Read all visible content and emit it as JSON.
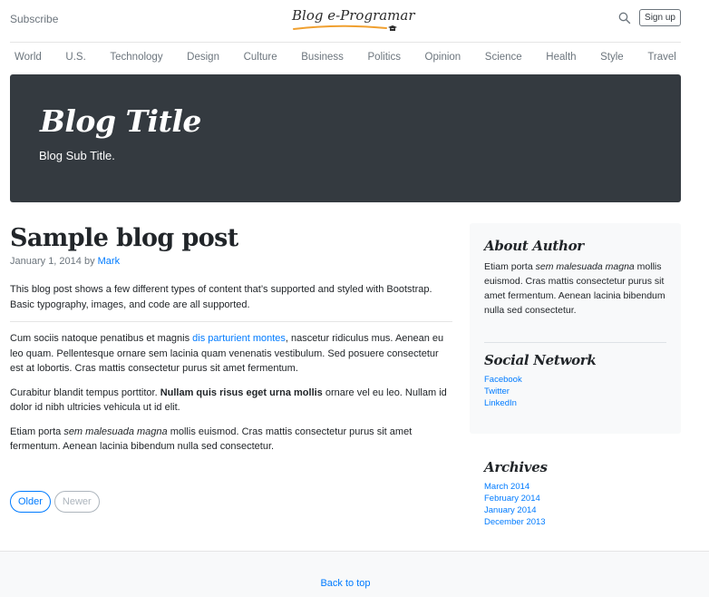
{
  "header": {
    "subscribe": "Subscribe",
    "logo": "Blog e-Programar",
    "signup": "Sign up",
    "search_icon": "search-icon"
  },
  "nav": {
    "items": [
      "World",
      "U.S.",
      "Technology",
      "Design",
      "Culture",
      "Business",
      "Politics",
      "Opinion",
      "Science",
      "Health",
      "Style",
      "Travel"
    ]
  },
  "jumbotron": {
    "title": "Blog Title",
    "subtitle": "Blog Sub Title."
  },
  "post": {
    "title": "Sample blog post",
    "date": "January 1, 2014 by",
    "author": "Mark",
    "intro": "This blog post shows a few different types of content that’s supported and styled with Bootstrap. Basic typography, images, and code are all supported.",
    "p2_before": "Cum sociis natoque penatibus et magnis ",
    "p2_link": "dis parturient montes",
    "p2_after": ", nascetur ridiculus mus. Aenean eu leo quam. Pellentesque ornare sem lacinia quam venenatis vestibulum. Sed posuere consectetur est at lobortis. Cras mattis consectetur purus sit amet fermentum.",
    "p3_before": "Curabitur blandit tempus porttitor. ",
    "p3_bold": "Nullam quis risus eget urna mollis",
    "p3_after": " ornare vel eu leo. Nullam id dolor id nibh ultricies vehicula ut id elit.",
    "p4_before": "Etiam porta ",
    "p4_em": "sem malesuada magna",
    "p4_after": " mollis euismod. Cras mattis consectetur purus sit amet fermentum. Aenean lacinia bibendum nulla sed consectetur."
  },
  "pager": {
    "older": "Older",
    "newer": "Newer"
  },
  "sidebar": {
    "about_title": "About Author",
    "about_before": "Etiam porta ",
    "about_em": "sem malesuada magna",
    "about_after": " mollis euismod. Cras mattis consectetur purus sit amet fermentum. Aenean lacinia bibendum nulla sed consectetur.",
    "social_title": "Social Network",
    "social_links": [
      "Facebook",
      "Twitter",
      "LinkedIn"
    ],
    "archives_title": "Archives",
    "archives_links": [
      "March 2014",
      "February 2014",
      "January 2014",
      "December 2013"
    ]
  },
  "footer": {
    "back_to_top": "Back to top"
  },
  "colors": {
    "accent": "#007bff",
    "jumbotron_bg": "#343a40",
    "sidebar_bg": "#f8f9fa",
    "logo_swoosh": "#f0a030"
  }
}
